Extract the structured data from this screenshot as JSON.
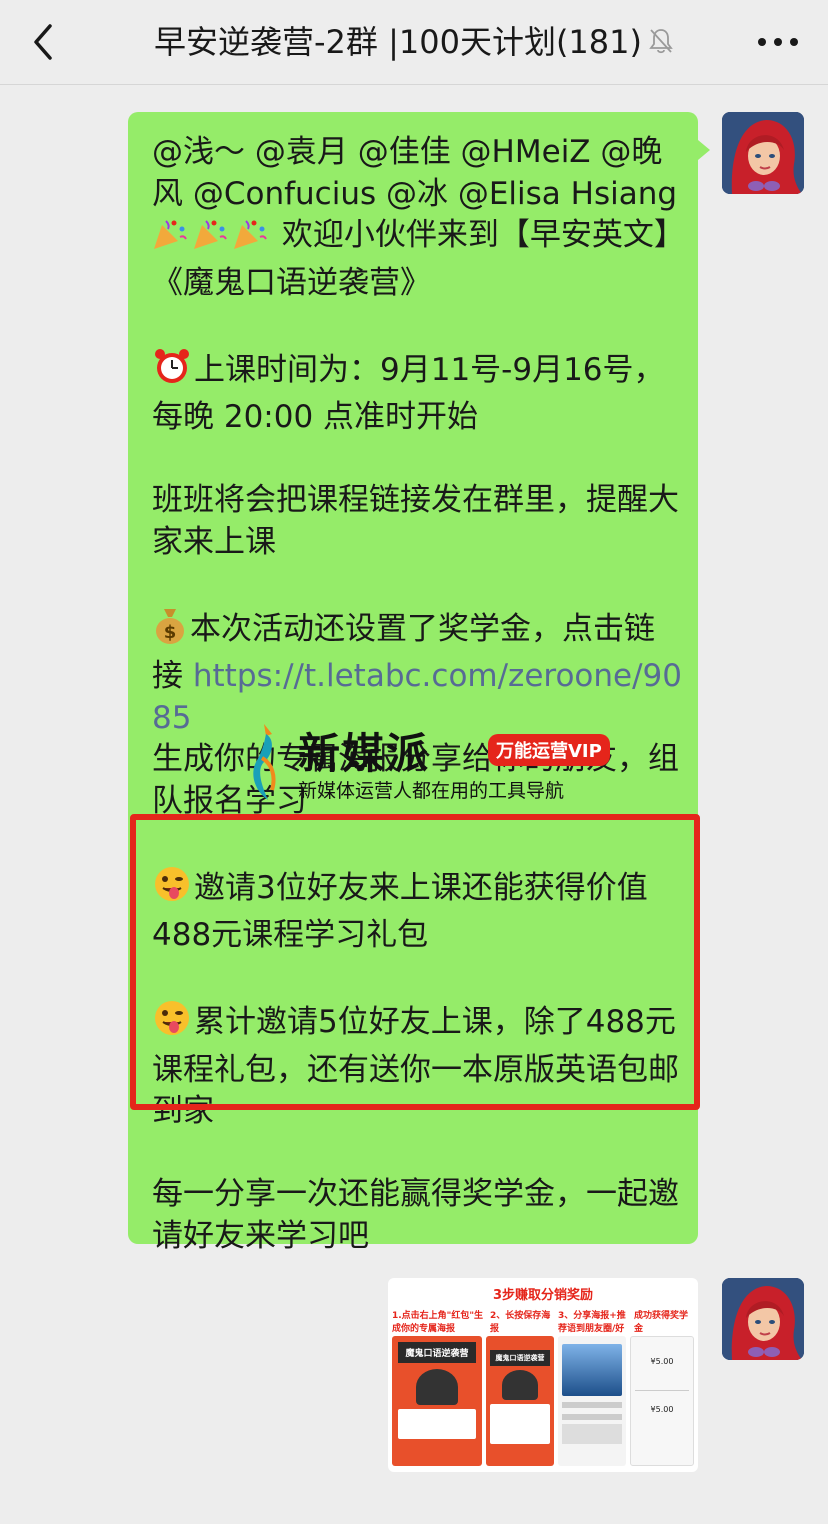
{
  "header": {
    "title": "早安逆袭营-2群 |100天计划(181)"
  },
  "icons": {
    "back": "chevron-left-icon",
    "mute": "bell-off-icon",
    "more": "more-dots-icon",
    "alarm": "alarm-clock-emoji",
    "money": "money-bag-emoji",
    "tongue": "tongue-face-emoji",
    "party": "party-popper-emoji"
  },
  "message": {
    "intro": "@浅～ @袁月 @佳佳 @HMeiZ @晚风 @Confucius @冰 @Elisa Hsiang",
    "welcome": "欢迎小伙伴来到【早安英文】《魔鬼口语逆袭营》",
    "schedule": "上课时间为：9月11号-9月16号，每晚 20:00 点准时开始",
    "class_note": "班班将会把课程链接发在群里，提醒大家来上课",
    "scholarship_prefix": "本次活动还设置了奖学金，点击链接",
    "scholarship_link": "https://t.letabc.com/zeroone/9085",
    "scholarship_suffix": "生成你的专属海报分享给你的朋友，组队报名学习",
    "invite_three": "邀请3位好友来上课还能获得价值488元课程学习礼包",
    "invite_five": "累计邀请5位好友上课，除了488元课程礼包，还有送你一本原版英语包邮到家",
    "share_reward": "每一分享一次还能赢得奖学金，一起邀请好友来学习吧"
  },
  "watermark": {
    "brand": "新媒派",
    "badge": "万能运营VIP",
    "tagline": "新媒体运营人都在用的工具导航"
  },
  "poster": {
    "title": "3步赚取分销奖励",
    "step1": "1.点击右上角\"红包\"生成你的专属海报",
    "step2": "2、长按保存海报",
    "step3": "3、分享海报+推荐语到朋友圈/好友",
    "step4": "成功获得奖学金",
    "course_name": "魔鬼口语逆袭营",
    "price": "¥5.00"
  },
  "colors": {
    "bubble": "#95ec69",
    "highlight": "#e5251b",
    "link": "#576b95",
    "background": "#ededed"
  }
}
